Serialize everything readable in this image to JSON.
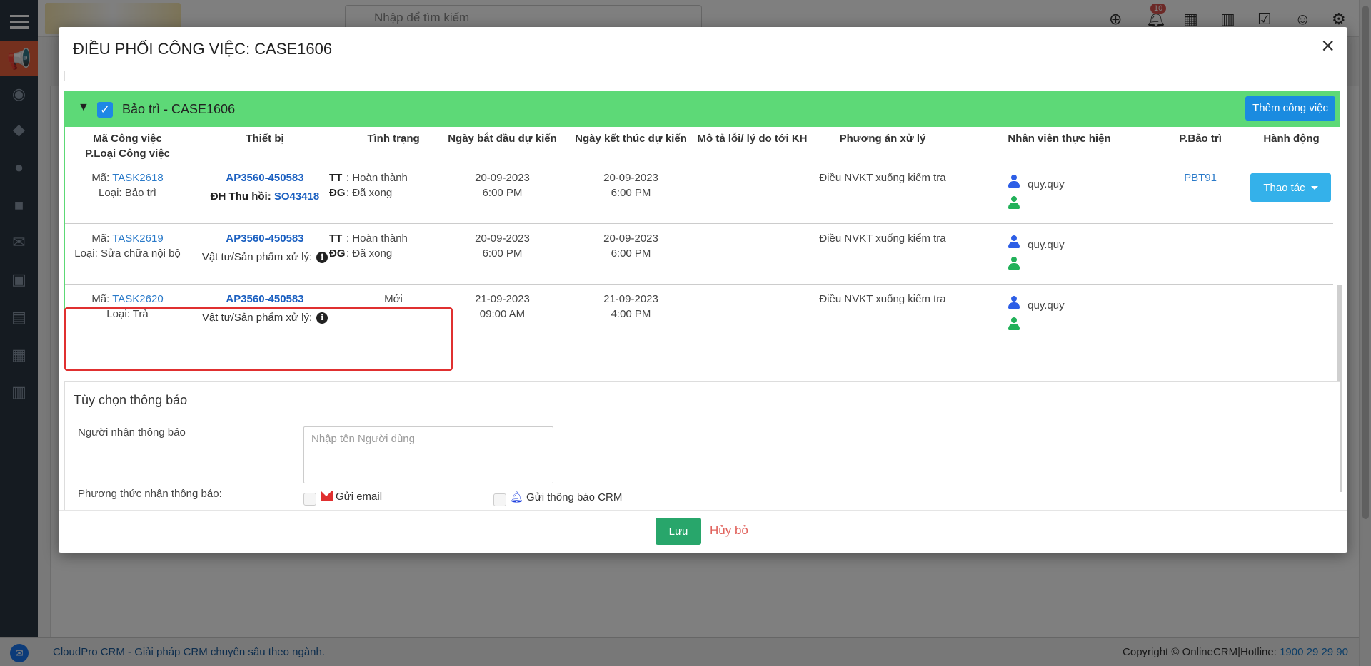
{
  "app": {
    "search_placeholder": "Nhập để tìm kiếm",
    "notification_count": "10",
    "footer_left": "CloudPro CRM - Giải pháp CRM chuyên sâu theo ngành.",
    "footer_right": "Copyright © OnlineCRM|Hotline: ",
    "hotline": "1900 29 29 90"
  },
  "modal": {
    "title": "ĐIỀU PHỐI CÔNG VIỆC: CASE1606",
    "close": "×",
    "group": {
      "title": "Bảo trì - CASE1606",
      "add_button": "Thêm công việc"
    },
    "headers": {
      "task_code": "Mã Công việc",
      "task_type": "P.Loại Công việc",
      "device": "Thiết bị",
      "status": "Tình trạng",
      "start": "Ngày bắt đầu dự kiến",
      "end": "Ngày kết thúc dự kiến",
      "desc": "Mô tả lỗi/ lý do tới KH",
      "solution": "Phương án xử lý",
      "staff": "Nhân viên thực hiện",
      "maint": "P.Bảo trì",
      "action": "Hành động"
    },
    "rows": [
      {
        "code_label": "Mã:",
        "code": "TASK2618",
        "type_label": "Loại:",
        "type": "Bảo trì",
        "device": "AP3560-450583",
        "extra_label": "ĐH Thu hồi:",
        "extra_link": "SO43418",
        "status_tt_key": "TT",
        "status_tt": ": Hoàn thành",
        "status_dg_key": "ĐG",
        "status_dg": ": Đã xong",
        "start_date": "20-09-2023",
        "start_time": "6:00 PM",
        "end_date": "20-09-2023",
        "end_time": "6:00 PM",
        "solution": "Điều NVKT xuống kiểm tra",
        "staff": "quy.quy",
        "maint": "PBT91",
        "action": "Thao tác"
      },
      {
        "code_label": "Mã:",
        "code": "TASK2619",
        "type_label": "Loại:",
        "type": "Sửa chữa nội bộ",
        "device": "AP3560-450583",
        "material_label": "Vật tư/Sản phẩm xử lý:",
        "status_tt_key": "TT",
        "status_tt": ": Hoàn thành",
        "status_dg_key": "ĐG",
        "status_dg": ": Đã xong",
        "start_date": "20-09-2023",
        "start_time": "6:00 PM",
        "end_date": "20-09-2023",
        "end_time": "6:00 PM",
        "solution": "Điều NVKT xuống kiểm tra",
        "staff": "quy.quy"
      },
      {
        "code_label": "Mã:",
        "code": "TASK2620",
        "type_label": "Loại:",
        "type": "Trả",
        "device": "AP3560-450583",
        "material_label": "Vật tư/Sản phẩm xử lý:",
        "status": "Mới",
        "start_date": "21-09-2023",
        "start_time": "09:00 AM",
        "end_date": "21-09-2023",
        "end_time": "4:00 PM",
        "solution": "Điều NVKT xuống kiểm tra",
        "staff": "quy.quy"
      }
    ],
    "notify": {
      "title": "Tùy chọn thông báo",
      "recipient_label": "Người nhận thông báo",
      "recipient_placeholder": "Nhập tên Người dùng",
      "method_label": "Phương thức nhận thông báo:",
      "email_option": "Gửi email",
      "crm_option": "Gửi thông báo CRM"
    },
    "save": "Lưu",
    "cancel": "Hủy bỏ"
  },
  "colors": {
    "group_header": "#5dd977",
    "primary": "#1a8be0",
    "save": "#28a66b",
    "highlight": "#e03030"
  }
}
